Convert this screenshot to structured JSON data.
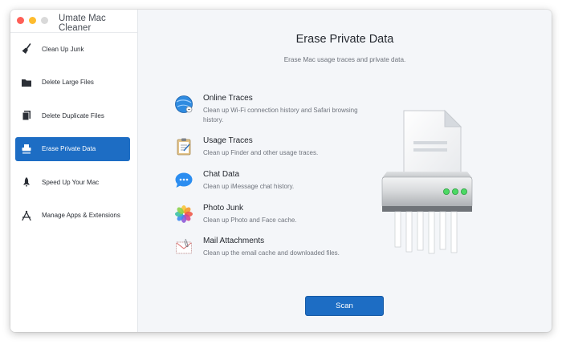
{
  "app": {
    "title": "Umate Mac Cleaner"
  },
  "sidebar": {
    "items": [
      {
        "label": "Clean Up Junk",
        "icon": "broom-icon"
      },
      {
        "label": "Delete Large Files",
        "icon": "folder-icon"
      },
      {
        "label": "Delete Duplicate Files",
        "icon": "duplicate-files-icon"
      },
      {
        "label": "Erase Private Data",
        "icon": "shredder-icon",
        "active": true
      },
      {
        "label": "Speed Up Your Mac",
        "icon": "rocket-icon"
      },
      {
        "label": "Manage Apps & Extensions",
        "icon": "app-store-icon"
      }
    ]
  },
  "main": {
    "title": "Erase Private Data",
    "subtitle": "Erase Mac usage traces and private data.",
    "features": [
      {
        "title": "Online Traces",
        "description": "Clean up Wi-Fi connection history and Safari browsing history.",
        "icon": "globe-icon"
      },
      {
        "title": "Usage Traces",
        "description": "Clean up Finder and other usage traces.",
        "icon": "clipboard-icon"
      },
      {
        "title": "Chat Data",
        "description": "Clean up iMessage chat history.",
        "icon": "chat-bubble-icon"
      },
      {
        "title": "Photo Junk",
        "description": "Clean up Photo and Face cache.",
        "icon": "photos-icon"
      },
      {
        "title": "Mail Attachments",
        "description": "Clean up the email cache and downloaded files.",
        "icon": "mail-attachment-icon"
      }
    ],
    "scan_label": "Scan"
  },
  "colors": {
    "accent": "#1d6dc4",
    "indicator_green": "#4cd964"
  }
}
